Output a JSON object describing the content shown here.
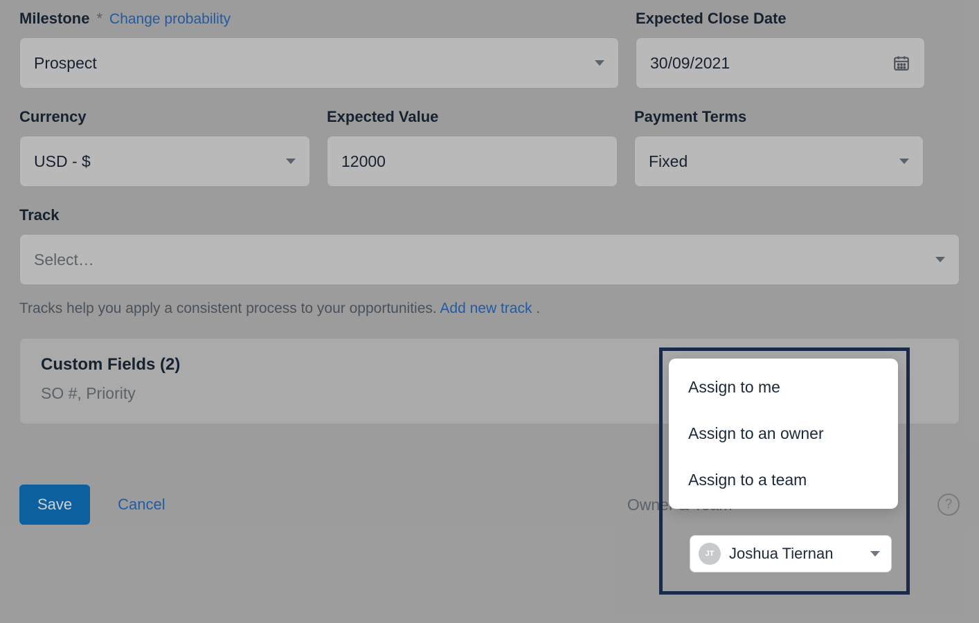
{
  "fields": {
    "milestone": {
      "label": "Milestone",
      "required_marker": "*",
      "change_link": "Change probability",
      "value": "Prospect"
    },
    "expected_close_date": {
      "label": "Expected Close Date",
      "value": "30/09/2021"
    },
    "currency": {
      "label": "Currency",
      "value": "USD - $"
    },
    "expected_value": {
      "label": "Expected Value",
      "value": "12000"
    },
    "payment_terms": {
      "label": "Payment Terms",
      "value": "Fixed"
    },
    "track": {
      "label": "Track",
      "placeholder": "Select…",
      "help_text": "Tracks help you apply a consistent process to your opportunities. ",
      "add_link": "Add new track",
      "help_suffix": " ."
    }
  },
  "custom_fields": {
    "title": "Custom Fields (2)",
    "summary": "SO #, Priority"
  },
  "footer": {
    "save": "Save",
    "cancel": "Cancel",
    "owner_label": "Owner & Team",
    "owner_name": "Joshua Tiernan",
    "owner_initials": "JT",
    "help": "?"
  },
  "assign_menu": {
    "items": [
      "Assign to me",
      "Assign to an owner",
      "Assign to a team"
    ]
  }
}
